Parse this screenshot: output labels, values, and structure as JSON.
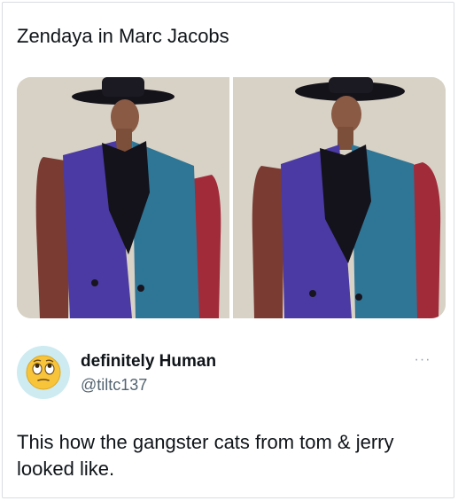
{
  "quoted_tweet": {
    "text": "Zendaya in Marc Jacobs"
  },
  "media": {
    "images": [
      {
        "description_icon": "photo"
      },
      {
        "description_icon": "photo"
      }
    ]
  },
  "author": {
    "display_name": "definitely Human",
    "handle": "@tiltc137",
    "avatar_icon": "face-with-rolling-eyes-emoji"
  },
  "more_menu": {
    "label": "···"
  },
  "tweet": {
    "text": "This how the gangster cats from tom & jerry looked like."
  },
  "colors": {
    "text": "#0f1419",
    "secondary": "#536471",
    "avatar_bg": "#cdebf1",
    "border": "#d9dde1"
  }
}
